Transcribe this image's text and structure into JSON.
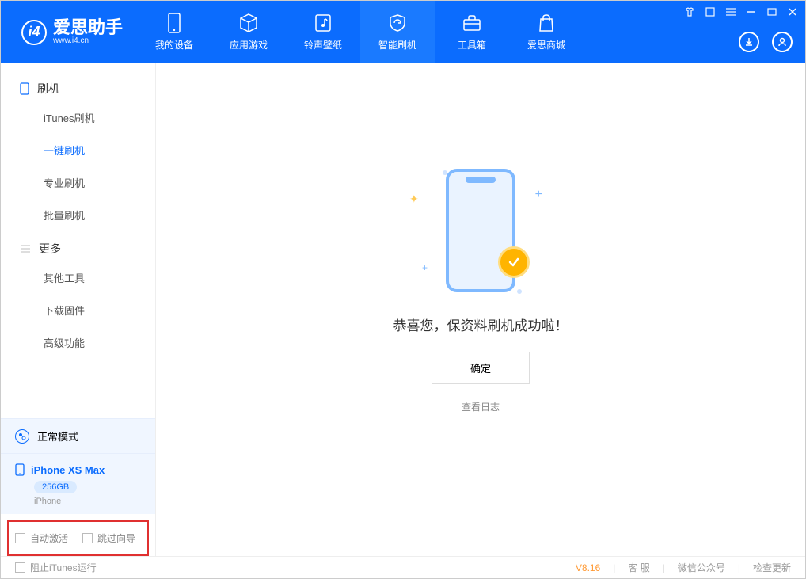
{
  "app": {
    "name": "爱思助手",
    "url": "www.i4.cn"
  },
  "nav": {
    "items": [
      {
        "label": "我的设备"
      },
      {
        "label": "应用游戏"
      },
      {
        "label": "铃声壁纸"
      },
      {
        "label": "智能刷机"
      },
      {
        "label": "工具箱"
      },
      {
        "label": "爱思商城"
      }
    ],
    "activeIndex": 3
  },
  "sidebar": {
    "section1": "刷机",
    "items1": [
      "iTunes刷机",
      "一键刷机",
      "专业刷机",
      "批量刷机"
    ],
    "section2": "更多",
    "items2": [
      "其他工具",
      "下载固件",
      "高级功能"
    ],
    "activeItem": "一键刷机"
  },
  "mode": {
    "label": "正常模式"
  },
  "device": {
    "name": "iPhone XS Max",
    "storage": "256GB",
    "type": "iPhone"
  },
  "checks": {
    "autoActivate": "自动激活",
    "skipGuide": "跳过向导"
  },
  "main": {
    "message": "恭喜您，保资料刷机成功啦！",
    "ok": "确定",
    "logLink": "查看日志"
  },
  "footer": {
    "blockItunes": "阻止iTunes运行",
    "version": "V8.16",
    "links": [
      "客 服",
      "微信公众号",
      "检查更新"
    ]
  }
}
